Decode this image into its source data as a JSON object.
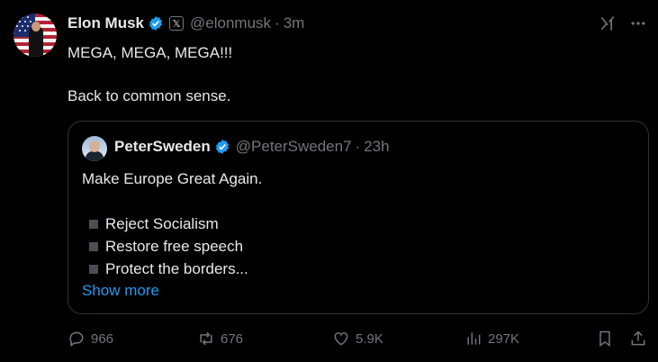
{
  "tweet": {
    "author_name": "Elon Musk",
    "author_handle": "@elonmusk",
    "time": "3m",
    "separator": "·",
    "lines": [
      "MEGA, MEGA, MEGA!!!",
      "",
      "Back to common sense."
    ]
  },
  "quote": {
    "author_name": "PeterSweden",
    "author_handle": "@PeterSweden7",
    "time": "23h",
    "separator": "·",
    "intro": "Make Europe Great Again.",
    "bullets": [
      "Reject Socialism",
      "Restore free speech",
      "Protect the borders..."
    ],
    "show_more": "Show more"
  },
  "actions": {
    "replies": "966",
    "reposts": "676",
    "likes": "5.9K",
    "views": "297K"
  },
  "colors": {
    "background": "#000000",
    "text": "#e7e9ea",
    "muted": "#71767b",
    "accent": "#1d9bf0",
    "border": "#2f3336"
  },
  "icons": [
    "verified-badge-icon",
    "x-affiliate-icon",
    "grok-icon",
    "more-icon",
    "reply-icon",
    "repost-icon",
    "like-icon",
    "views-icon",
    "bookmark-icon",
    "share-icon"
  ]
}
